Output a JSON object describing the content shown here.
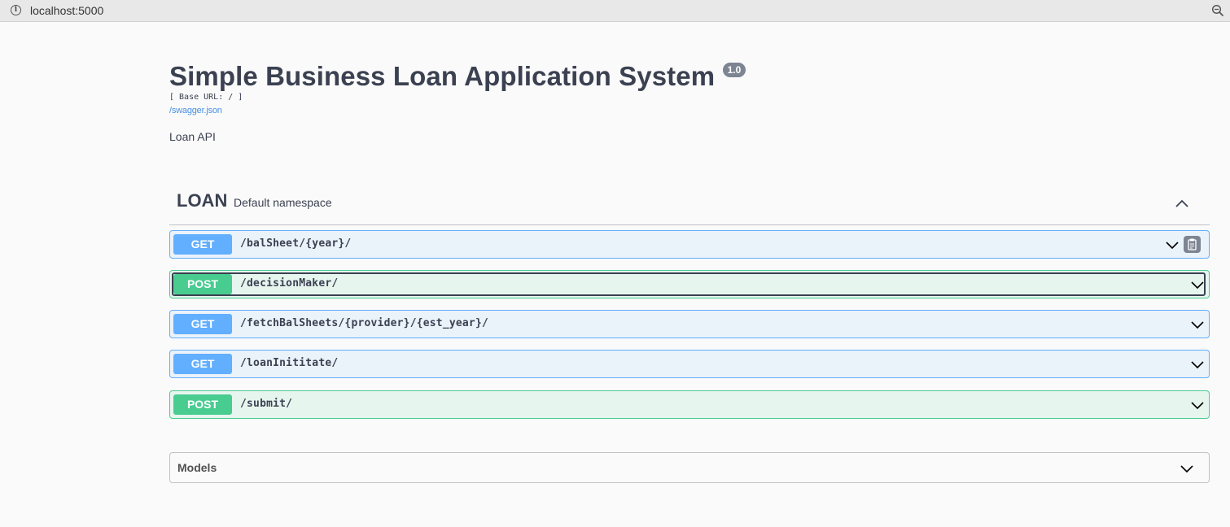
{
  "browser": {
    "url": "localhost:5000",
    "info_icon": "info-circle-icon",
    "zoom_icon": "zoom-icon"
  },
  "info": {
    "title": "Simple Business Loan Application System",
    "version": "1.0",
    "base_url": "[ Base URL: / ]",
    "spec_link": "/swagger.json",
    "description": "Loan API"
  },
  "tag": {
    "name": "LOAN",
    "description": "Default namespace",
    "expanded": true
  },
  "operations": [
    {
      "method": "GET",
      "path": "/balSheet/{year}/"
    },
    {
      "method": "POST",
      "path": "/decisionMaker/"
    },
    {
      "method": "GET",
      "path": "/fetchBalSheets/{provider}/{est_year}/"
    },
    {
      "method": "GET",
      "path": "/loanInititate/"
    },
    {
      "method": "POST",
      "path": "/submit/"
    }
  ],
  "models": {
    "title": "Models"
  },
  "colors": {
    "get": "#61affe",
    "post": "#49cc90",
    "text": "#3b4151",
    "link": "#4990e2",
    "badge": "#7d8492"
  }
}
